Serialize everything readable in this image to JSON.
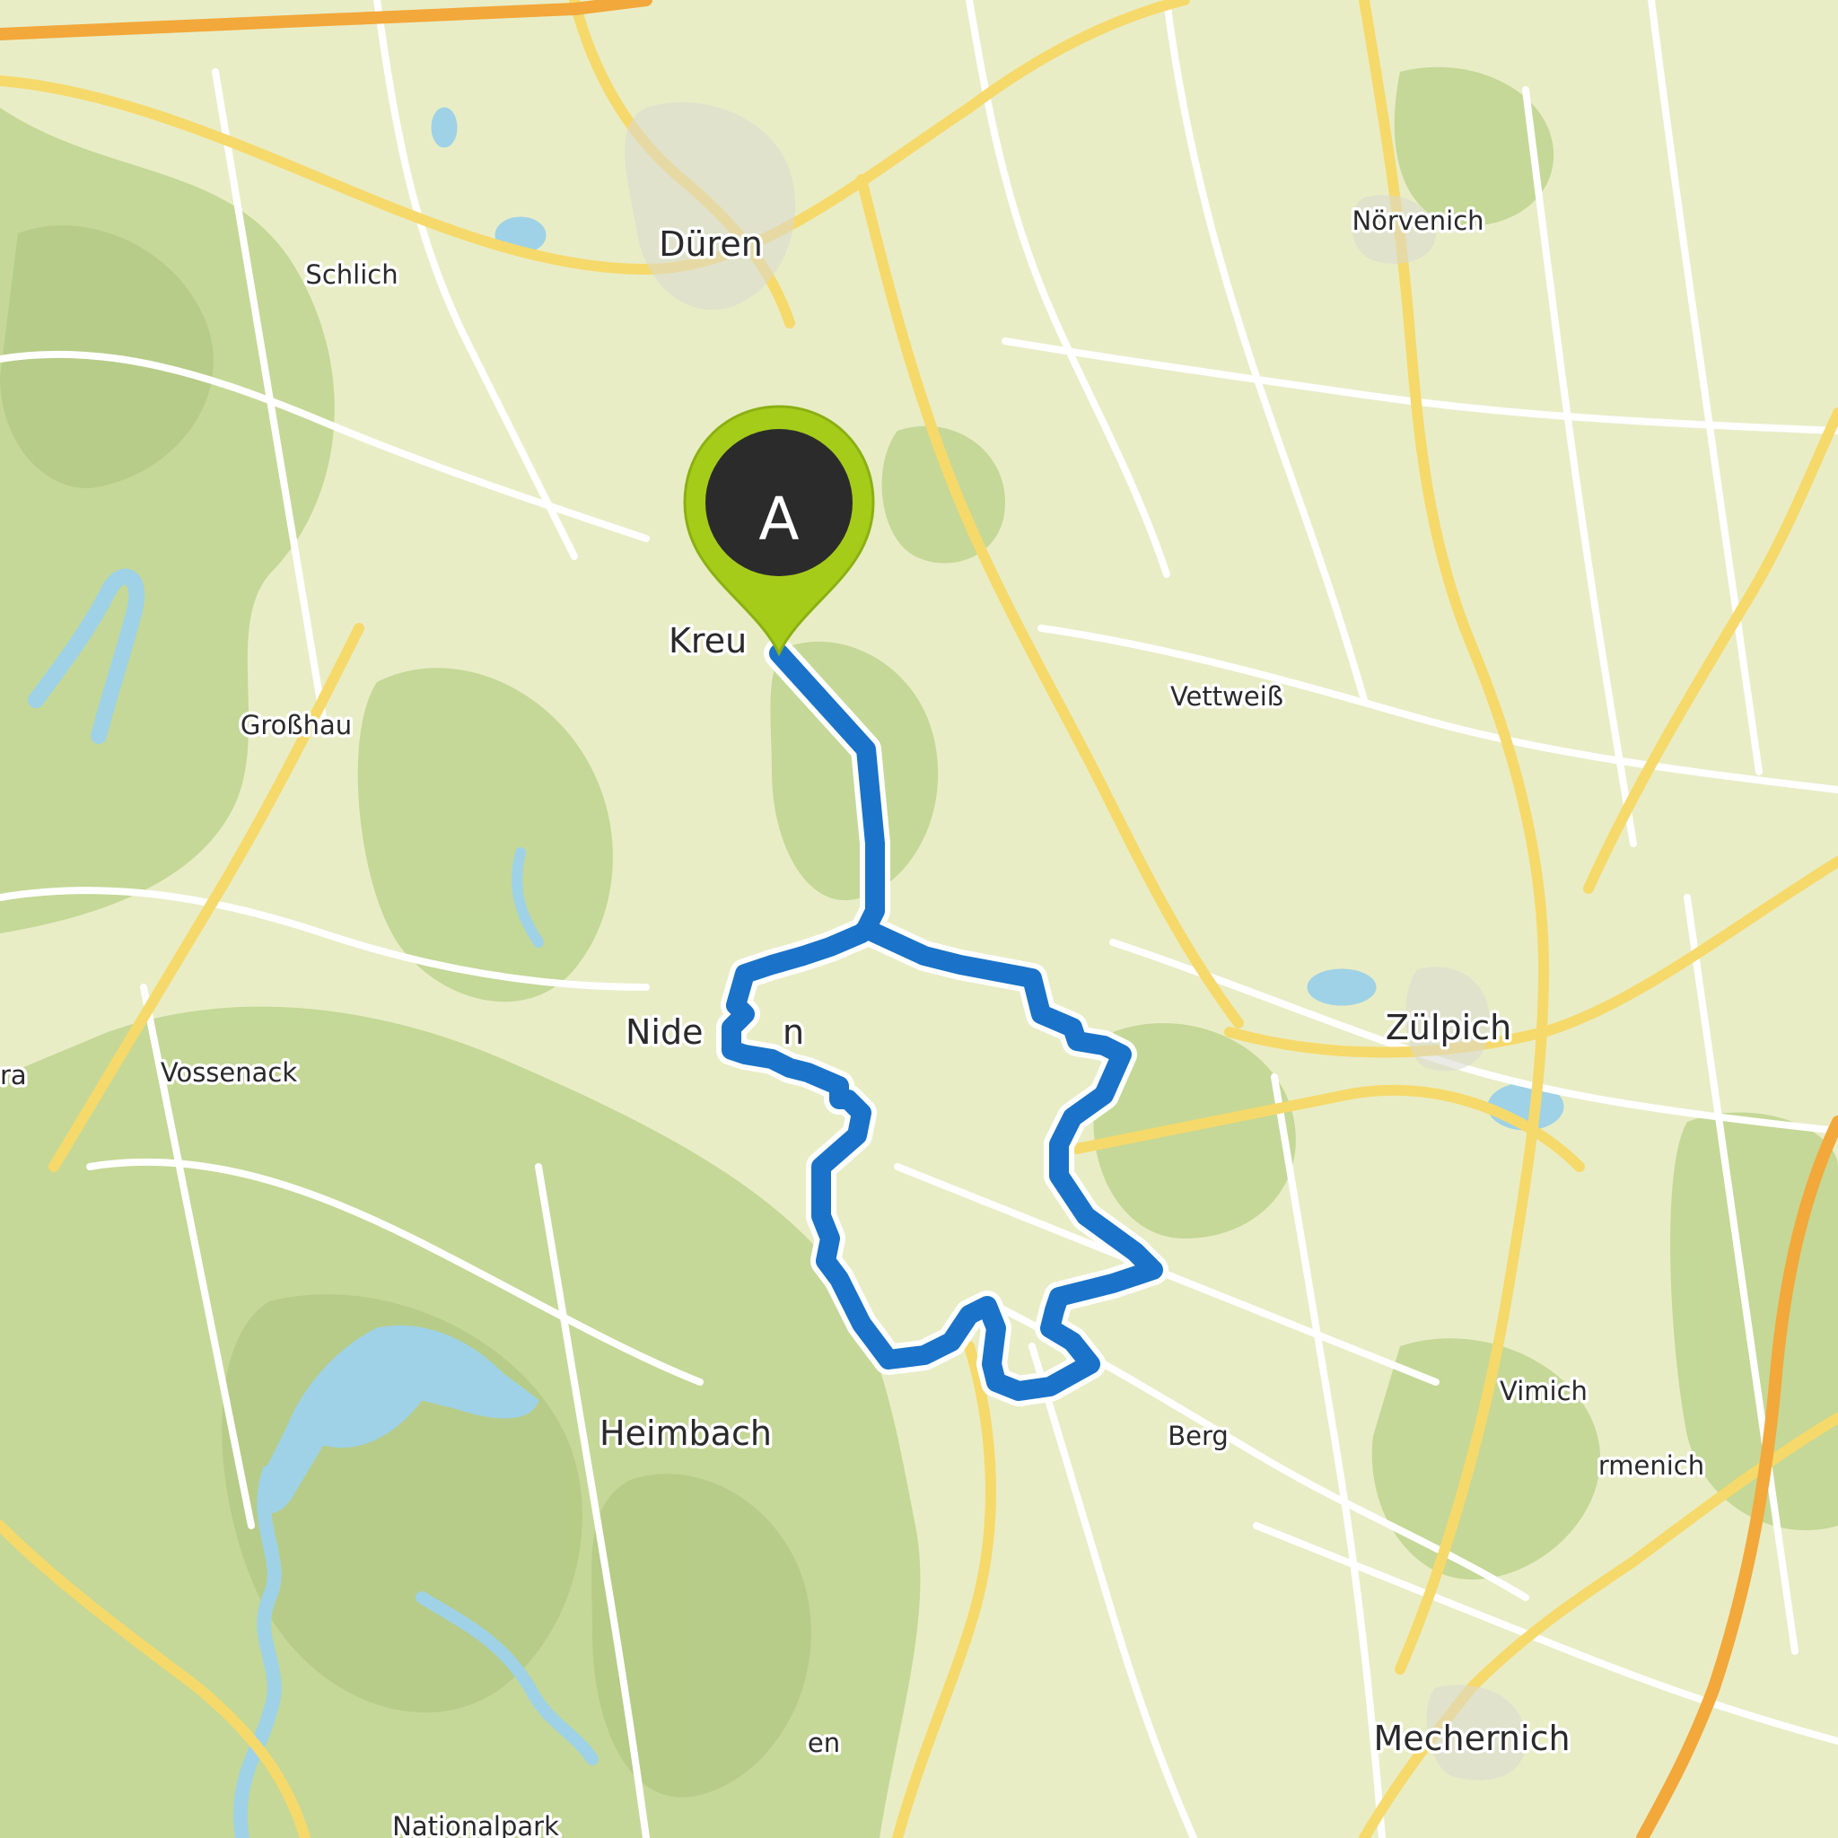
{
  "map": {
    "colors": {
      "land": "#e9edc6",
      "forest": "#c3d795",
      "water": "#9fd2e6",
      "road_minor": "#ffffff",
      "road_major": "#f6d96b",
      "motorway": "#f2a83a",
      "route": "#1a73c8",
      "marker_pin": "#a6cc1a",
      "marker_center": "#2b2b2b"
    },
    "marker": {
      "label": "A",
      "icon": "map-pin-icon"
    },
    "labels": {
      "dueren": "Düren",
      "schlich": "Schlich",
      "noervenich": "Nörvenich",
      "kreuzau": "Kreu",
      "grosshau": "Großhau",
      "vettweiss": "Vettweiß",
      "nideggen": "Nide",
      "nideggen_tail": "n",
      "zuelpich": "Zülpich",
      "vossenack": "Vossenack",
      "left_edge": "ra",
      "heimbach": "Heimbach",
      "berg": "Berg",
      "vimich": "Vimich",
      "ermenich": "rmenich",
      "mechernich": "Mechernich",
      "bottom_fragment": "en",
      "nationalpark": "Nationalpark"
    }
  }
}
